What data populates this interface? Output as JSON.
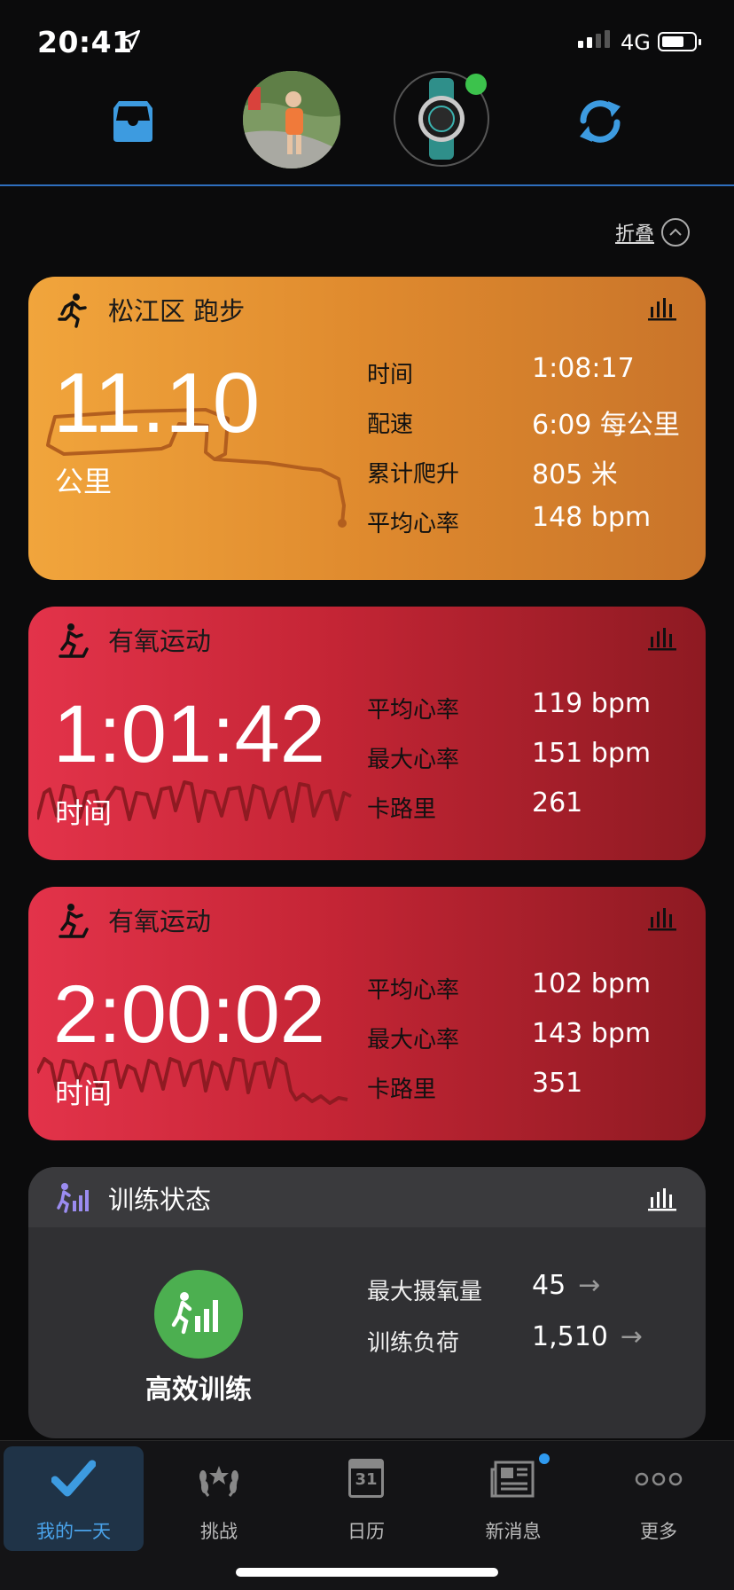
{
  "status_bar": {
    "time": "20:41",
    "network": "4G"
  },
  "collapse": {
    "label": "折叠"
  },
  "run_card": {
    "title": "松江区 跑步",
    "distance": "11.10",
    "distance_unit": "公里",
    "stats": [
      {
        "label": "时间",
        "value": "1:08:17"
      },
      {
        "label": "配速",
        "value": "6:09 每公里"
      },
      {
        "label": "累计爬升",
        "value": "805 米"
      },
      {
        "label": "平均心率",
        "value": "148 bpm"
      }
    ]
  },
  "cardio_cards": [
    {
      "title": "有氧运动",
      "duration": "1:01:42",
      "duration_label": "时间",
      "stats": [
        {
          "label": "平均心率",
          "value": "119 bpm"
        },
        {
          "label": "最大心率",
          "value": "151 bpm"
        },
        {
          "label": "卡路里",
          "value": "261"
        }
      ]
    },
    {
      "title": "有氧运动",
      "duration": "2:00:02",
      "duration_label": "时间",
      "stats": [
        {
          "label": "平均心率",
          "value": "102 bpm"
        },
        {
          "label": "最大心率",
          "value": "143 bpm"
        },
        {
          "label": "卡路里",
          "value": "351"
        }
      ]
    }
  ],
  "training_status": {
    "title": "训练状态",
    "status": "高效训练",
    "stats": [
      {
        "label": "最大摄氧量",
        "value": "45"
      },
      {
        "label": "训练负荷",
        "value": "1,510"
      }
    ]
  },
  "tabs": [
    {
      "label": "我的一天",
      "icon": "checkmark-icon",
      "active": true
    },
    {
      "label": "挑战",
      "icon": "laurel-icon"
    },
    {
      "label": "日历",
      "icon": "calendar-icon",
      "day": "31"
    },
    {
      "label": "新消息",
      "icon": "news-icon",
      "badge": true
    },
    {
      "label": "更多",
      "icon": "more-icon"
    }
  ],
  "colors": {
    "accent": "#4aa3ea",
    "run_card": "#e6922f",
    "cardio_card": "#c42535",
    "status_green": "#4caf50",
    "device_online": "#3cc24c"
  }
}
